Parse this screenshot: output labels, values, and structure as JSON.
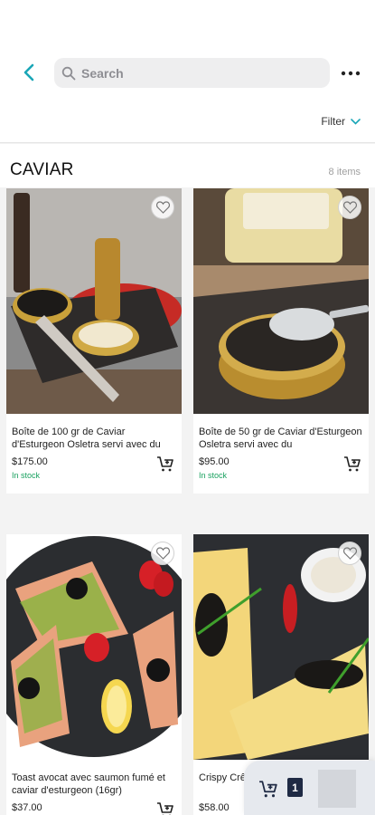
{
  "header": {
    "search_placeholder": "Search",
    "back_icon": "chevron-left-icon",
    "more_icon": "more-horizontal-icon"
  },
  "filter": {
    "label": "Filter"
  },
  "section": {
    "title": "CAVIAR",
    "count": "8 items"
  },
  "products": [
    {
      "name": "Boîte de 100 gr de Caviar d'Esturgeon Osletra servi avec du",
      "price": "$175.00",
      "stock": "In stock"
    },
    {
      "name": "Boîte de 50 gr de Caviar d'Esturgeon Osletra servi avec du",
      "price": "$95.00",
      "stock": "In stock"
    },
    {
      "name": "Toast avocat avec saumon fumé et caviar d'esturgeon (16gr)",
      "price": "$37.00",
      "stock": ""
    },
    {
      "name": "Crispy Crê… d'Esturge…",
      "price": "$58.00",
      "stock": ""
    }
  ],
  "mini_cart": {
    "count": "1"
  },
  "colors": {
    "accent": "#1aa6b7",
    "in_stock": "#19a15f",
    "badge": "#1f2a44"
  }
}
